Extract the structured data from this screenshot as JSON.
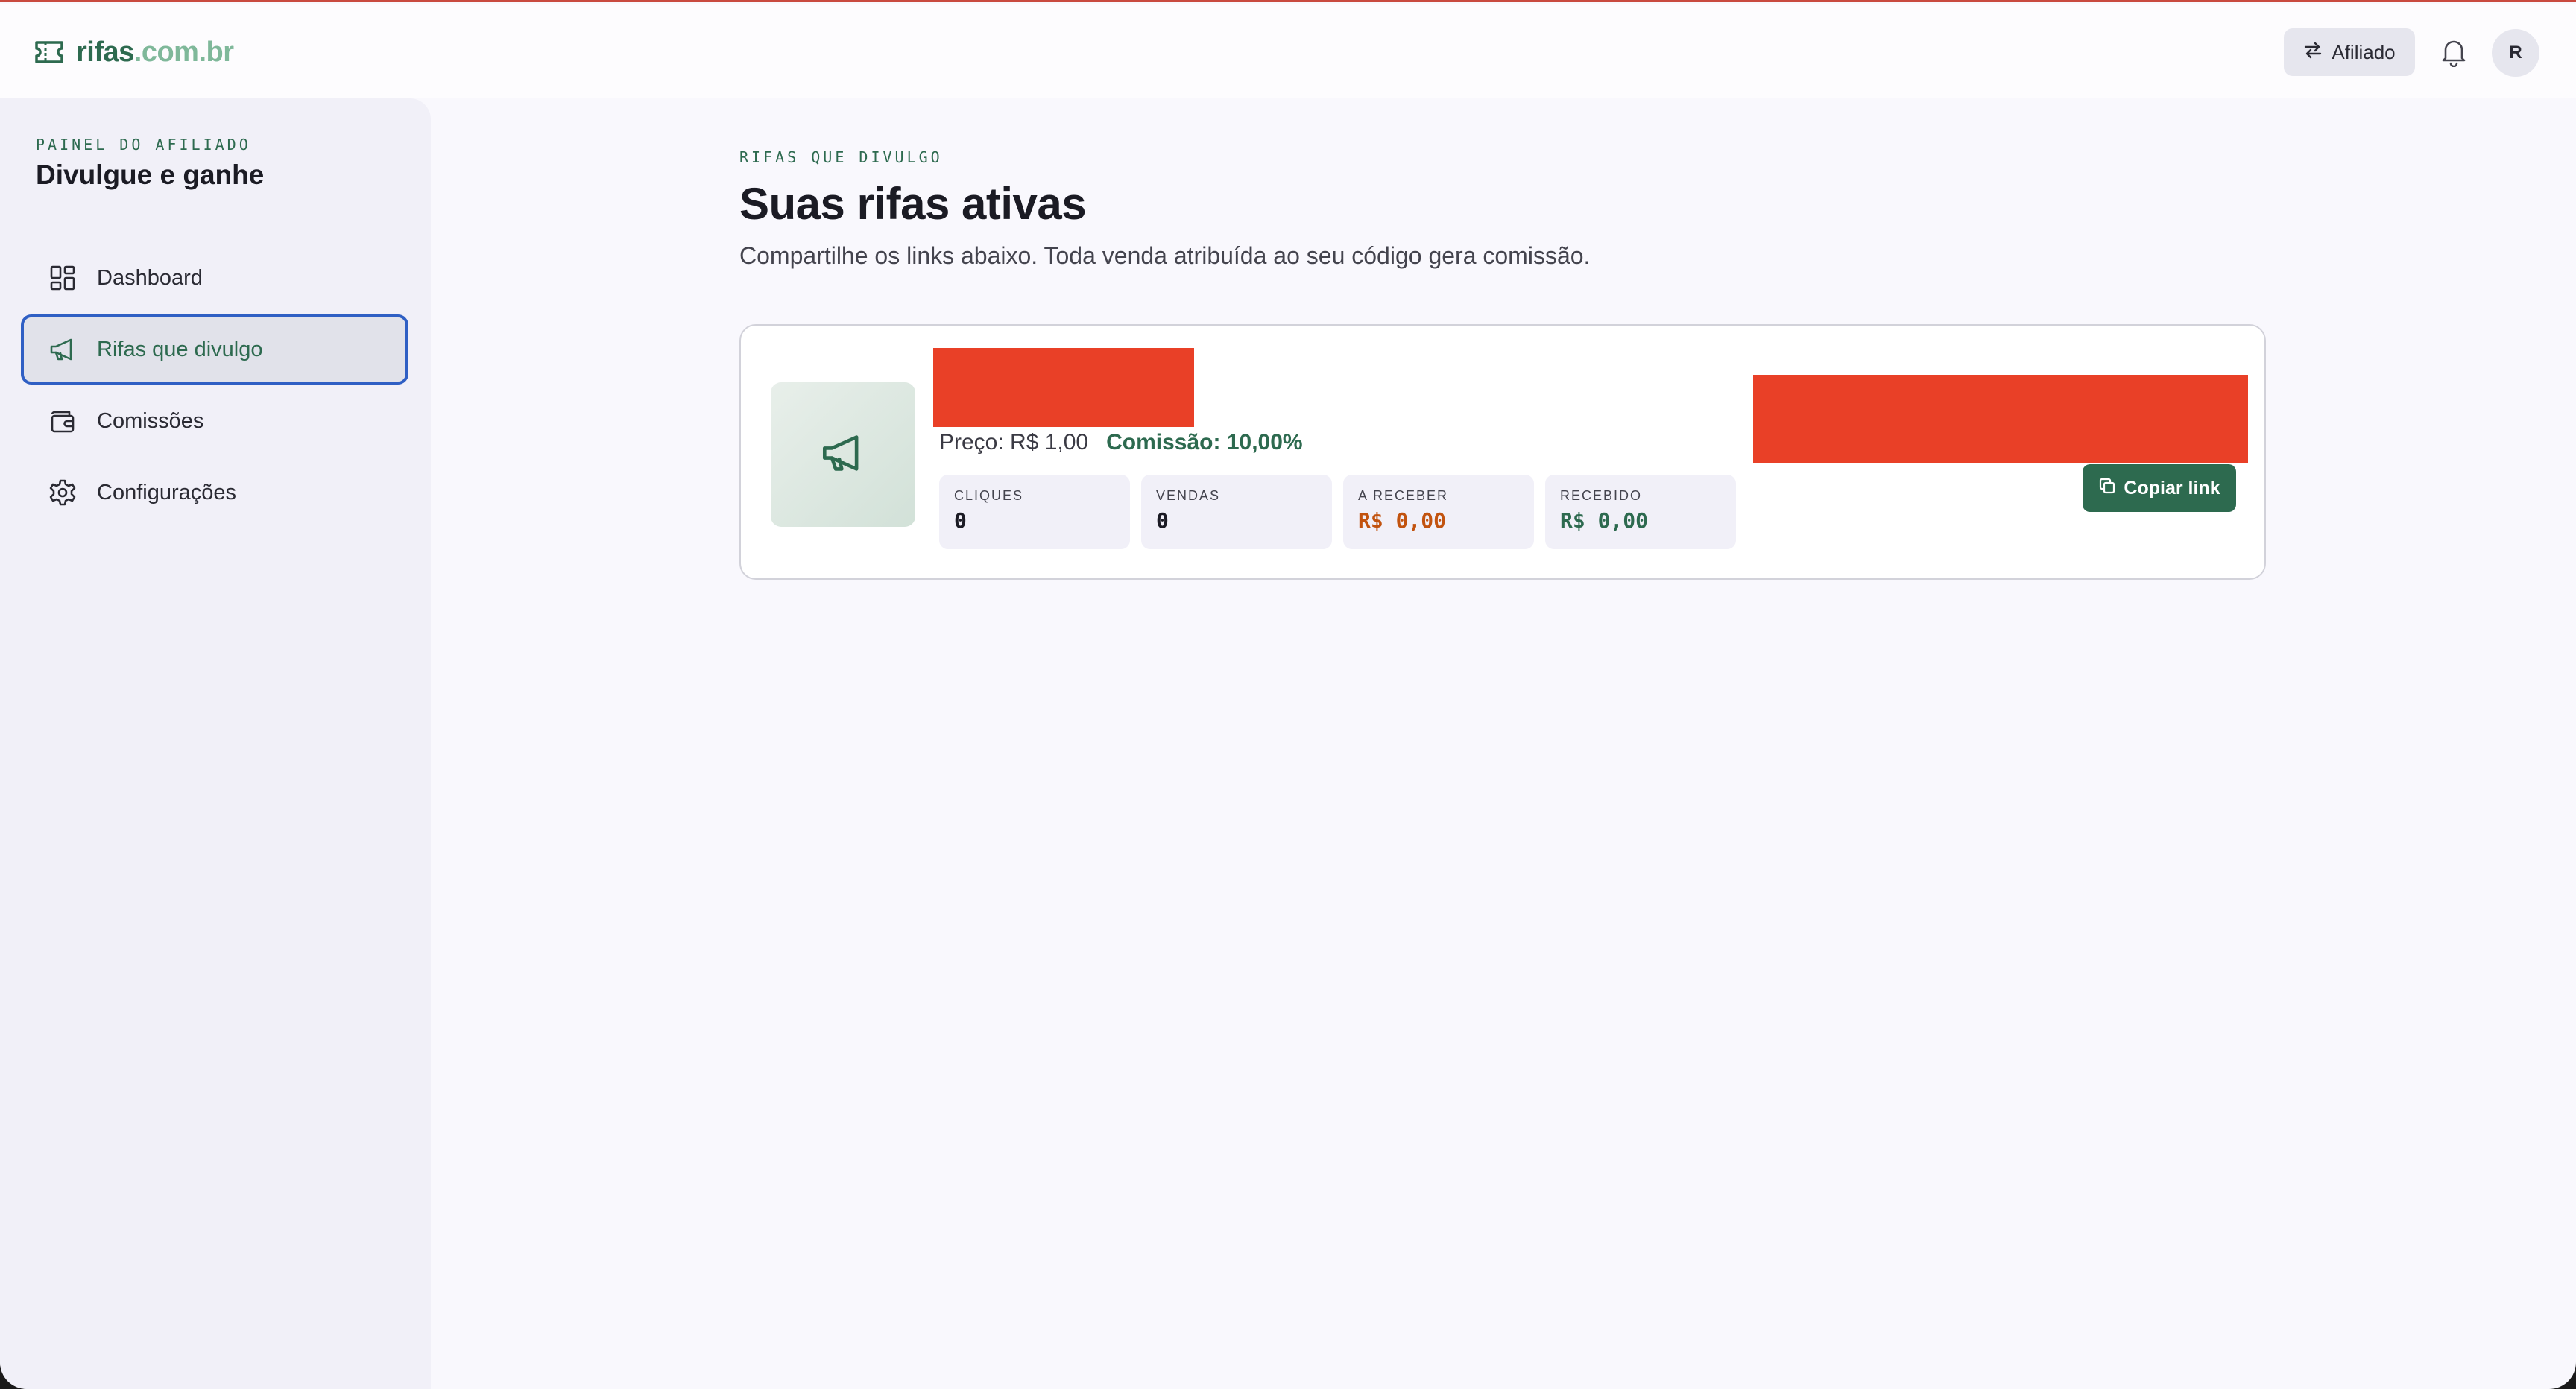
{
  "header": {
    "brand_name": "rifas",
    "brand_domain": ".com.br",
    "role_button_label": "Afiliado",
    "avatar_initial": "R"
  },
  "sidebar": {
    "eyebrow": "PAINEL DO AFILIADO",
    "title": "Divulgue e ganhe",
    "items": [
      {
        "label": "Dashboard",
        "icon": "dashboard-grid-icon",
        "active": false
      },
      {
        "label": "Rifas que divulgo",
        "icon": "megaphone-icon",
        "active": true
      },
      {
        "label": "Comissões",
        "icon": "wallet-icon",
        "active": false
      },
      {
        "label": "Configurações",
        "icon": "gear-icon",
        "active": false
      }
    ]
  },
  "main": {
    "eyebrow": "RIFAS QUE DIVULGO",
    "title": "Suas rifas ativas",
    "subtitle": "Compartilhe os links abaixo. Toda venda atribuída ao seu código gera comissão."
  },
  "raffle_card": {
    "thumbnail_icon": "megaphone-icon",
    "price_text": "Preço: R$ 1,00",
    "commission_text": "Comissão: 10,00%",
    "stats": [
      {
        "label": "CLIQUES",
        "value": "0",
        "color": "#1b1b24"
      },
      {
        "label": "VENDAS",
        "value": "0",
        "color": "#1b1b24"
      },
      {
        "label": "A RECEBER",
        "value": "R$ 0,00",
        "color": "#c2530f"
      },
      {
        "label": "RECEBIDO",
        "value": "R$ 0,00",
        "color": "#2d6a4f"
      }
    ],
    "copy_button_label": "Copiar link"
  },
  "colors": {
    "accent": "#2d6a4f",
    "redaction": "#e94027",
    "active_border": "#2f5fc4"
  }
}
